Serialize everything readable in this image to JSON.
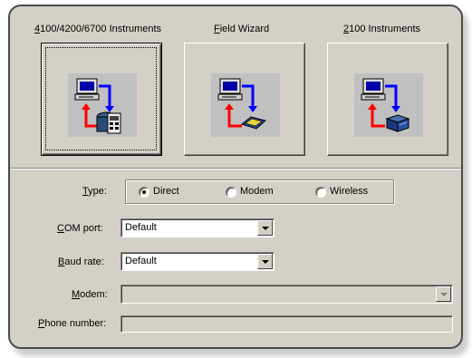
{
  "tabs": [
    {
      "label": "4100/4200/6700 Instruments",
      "icon": "pc-to-portable-instrument-icon",
      "selected": true
    },
    {
      "label": "Field Wizard",
      "icon": "pc-to-field-wizard-icon",
      "selected": false
    },
    {
      "label": "2100 Instruments",
      "icon": "pc-to-2100-instrument-icon",
      "selected": false
    }
  ],
  "type": {
    "label": "Type:",
    "options": [
      "Direct",
      "Modem",
      "Wireless"
    ],
    "selected": "Direct"
  },
  "com_port": {
    "label": "COM port:",
    "value": "Default"
  },
  "baud_rate": {
    "label": "Baud rate:",
    "value": "Default"
  },
  "modem": {
    "label": "Modem:",
    "value": "",
    "enabled": false
  },
  "phone_number": {
    "label": "Phone number:",
    "value": "",
    "enabled": false
  },
  "colors": {
    "arrow_red": "#ff0000",
    "arrow_blue": "#0000ff",
    "icon_bg": "#c0c0c0",
    "panel_bg": "#d4d0c8"
  }
}
